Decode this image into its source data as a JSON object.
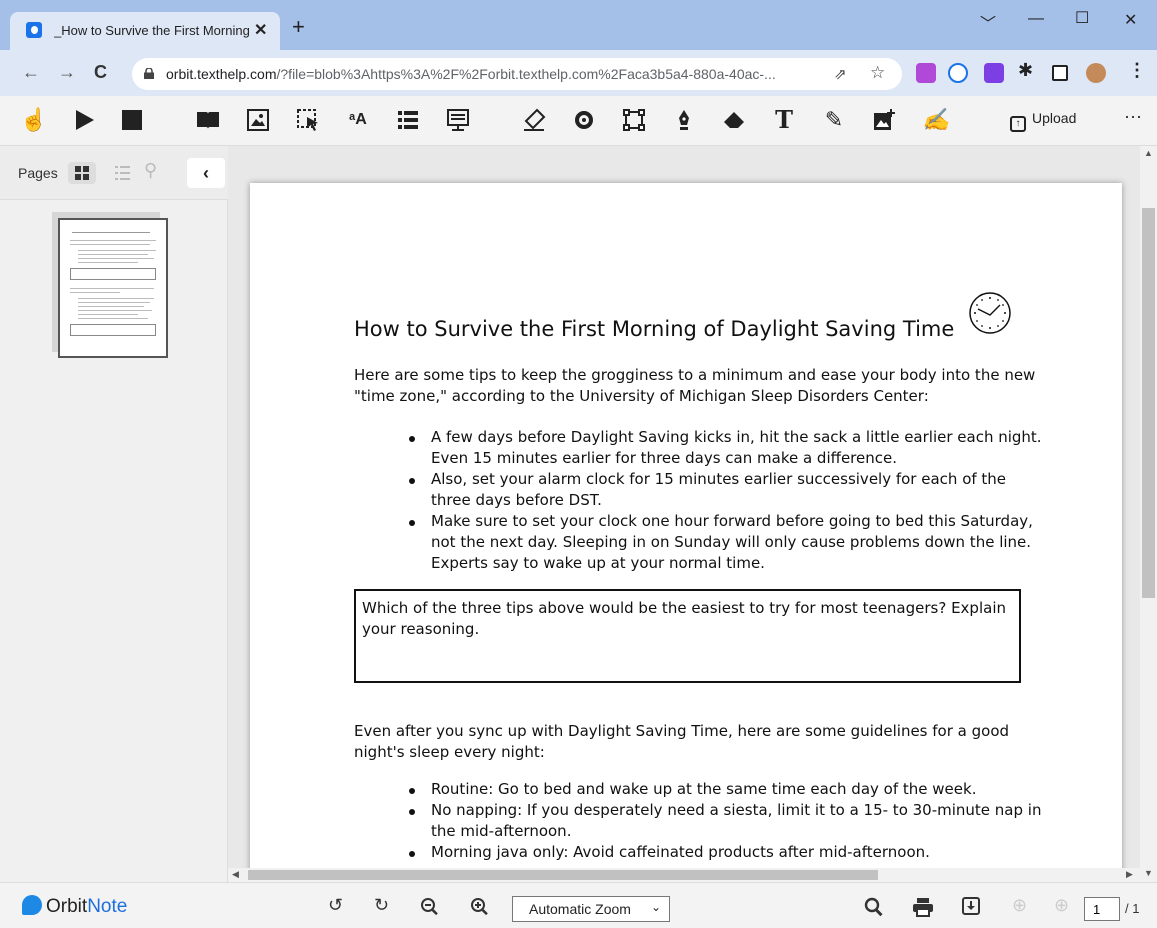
{
  "browser": {
    "tab_title": "_How to Survive the First Morning of Daylight Saving Time",
    "tab_close": "✕",
    "new_tab": "+",
    "url_host": "orbit.texthelp.com",
    "url_rest": "/?file=blob%3Ahttps%3A%2F%2Forbit.texthelp.com%2Faca3b5a4-880a-40ac-..."
  },
  "toolbar": {
    "upload_label": "Upload",
    "more_label": "···"
  },
  "sidebar": {
    "pages_label": "Pages"
  },
  "document": {
    "title": "How to Survive the First Morning of Daylight Saving Time",
    "intro_line1": "Here are some tips to keep the grogginess to a minimum and ease your body into the new",
    "intro_line2": "\"time zone,\" according to the University of Michigan Sleep Disorders Center:",
    "tips": [
      [
        "A few days before Daylight Saving kicks in, hit the sack a little earlier each night.",
        "Even 15 minutes earlier for three days can make a difference."
      ],
      [
        "Also, set your alarm clock for 15 minutes earlier successively for each of the",
        "three days before DST."
      ],
      [
        "Make sure to set your clock one hour forward before going to bed this Saturday,",
        "not the next day. Sleeping in on Sunday will only cause problems down the line.",
        "Experts say to wake up at your normal time."
      ]
    ],
    "question_line1": "Which of the three tips above would be the easiest to try for most teenagers?  Explain",
    "question_line2": "your reasoning.",
    "guide_line1": "Even after you sync up with Daylight Saving Time, here are some guidelines for a good",
    "guide_line2": "night's sleep every night:",
    "guidelines": [
      [
        "Routine: Go to bed and wake up at the same time each day of the week."
      ],
      [
        "No napping: If you desperately need a siesta, limit it to a 15- to 30-minute nap in",
        "the mid-afternoon."
      ],
      [
        "Morning java only: Avoid caffeinated products after mid-afternoon."
      ]
    ]
  },
  "bottom": {
    "brand_prefix": "Orbit",
    "brand_suffix": "Note",
    "zoom_value": "Automatic Zoom",
    "page_number": "1",
    "page_total": "/ 1"
  }
}
